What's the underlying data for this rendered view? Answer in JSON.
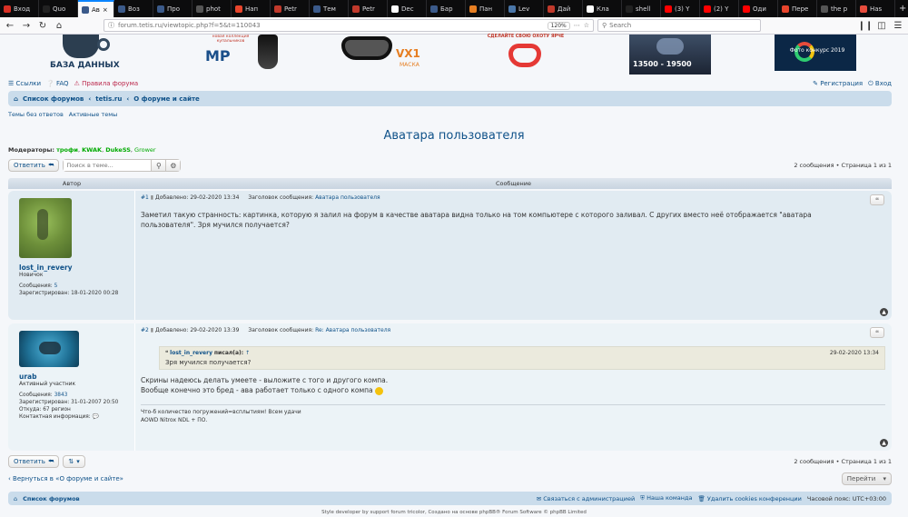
{
  "browser": {
    "tabs": [
      {
        "label": "Вход",
        "color": "#d93025",
        "icon": "gmail-icon"
      },
      {
        "label": "Quo",
        "color": "#222",
        "icon": "p-icon"
      },
      {
        "label": "Ав",
        "color": "#3b5a8a",
        "icon": "forum-icon",
        "active": true
      },
      {
        "label": "Воз",
        "color": "#3b5a8a",
        "icon": "forum-icon"
      },
      {
        "label": "Про",
        "color": "#3b5a8a",
        "icon": "forum-icon"
      },
      {
        "label": "phot",
        "color": "#555",
        "icon": "page-icon"
      },
      {
        "label": "Нап",
        "color": "#e8452c",
        "icon": "s-icon"
      },
      {
        "label": "Petr",
        "color": "#c0392b",
        "icon": "c-icon"
      },
      {
        "label": "Тем",
        "color": "#3b5a8a",
        "icon": "forum-icon"
      },
      {
        "label": "Petr",
        "color": "#c0392b",
        "icon": "c-icon"
      },
      {
        "label": "Dec",
        "color": "#fff",
        "icon": "w-icon"
      },
      {
        "label": "Бар",
        "color": "#3b5a8a",
        "icon": "forum-icon"
      },
      {
        "label": "Пан",
        "color": "#e67e22",
        "icon": "pin-icon"
      },
      {
        "label": "Lev",
        "color": "#4a76a8",
        "icon": "vk-icon"
      },
      {
        "label": "Дай",
        "color": "#c0392b",
        "icon": "stripe-icon"
      },
      {
        "label": "Кла",
        "color": "#fff",
        "icon": "w-icon"
      },
      {
        "label": "shell",
        "color": "#222",
        "icon": "a-icon"
      },
      {
        "label": "(3) Y",
        "color": "#ff0000",
        "icon": "youtube-icon"
      },
      {
        "label": "(2) Y",
        "color": "#ff0000",
        "icon": "youtube-icon"
      },
      {
        "label": "Оди",
        "color": "#ff0000",
        "icon": "youtube-icon"
      },
      {
        "label": "Пере",
        "color": "#e8452c",
        "icon": "g-icon"
      },
      {
        "label": "the p",
        "color": "#555",
        "icon": "page-icon"
      },
      {
        "label": "Has",
        "color": "#e74c3c",
        "icon": "h-icon"
      }
    ],
    "url": "forum.tetis.ru/viewtopic.php?f=5&t=110043",
    "zoom": "120%",
    "search_placeholder": "Search"
  },
  "banners": {
    "db_label": "БАЗА ДАННЫХ",
    "mp_text": "новая коллекция купальников",
    "mp_logo": "MP",
    "vx1": "VX1",
    "vx1_sub": "МАСКА",
    "hunt": "СДЕЛАЙТЕ СВОЮ ОХОТУ ЯРЧЕ",
    "price": "13500 - 19500",
    "contest": "Фото конкурс 2019"
  },
  "header": {
    "links": [
      "Ссылки",
      "FAQ",
      "Правила форума"
    ],
    "register": "Регистрация",
    "login": "Вход"
  },
  "breadcrumb": [
    "Список форумов",
    "tetis.ru",
    "О форуме и сайте"
  ],
  "quicklinks": [
    "Темы без ответов",
    "Активные темы"
  ],
  "topic": {
    "title": "Аватара пользователя",
    "mods_label": "Модераторы:",
    "mods": [
      "трофи",
      "KWAK",
      "DukeSS",
      "Grower"
    ],
    "reply_label": "Ответить",
    "search_placeholder": "Поиск в теме...",
    "pagination": "2 сообщения • Страница 1 из 1"
  },
  "table_header": {
    "author": "Автор",
    "message": "Сообщение"
  },
  "posts": [
    {
      "num": "#1",
      "date": "Добавлено: 29-02-2020 13:34",
      "subject_label": "Заголовок сообщения:",
      "subject": "Аватара пользователя",
      "author": "lost_in_revery",
      "rank": "Новичок",
      "messages_label": "Сообщения:",
      "messages": "5",
      "registered_label": "Зарегистрирован:",
      "registered": "18-01-2020 00:28",
      "text": "Заметил такую странность: картинка, которую я залил на форум в качестве аватара видна только на том компьютере с которого заливал. С других вместо неё отображается \"аватара пользователя\". Зря мучился получается?"
    },
    {
      "num": "#2",
      "date": "Добавлено: 29-02-2020 13:39",
      "subject_label": "Заголовок сообщения:",
      "subject": "Re: Аватара пользователя",
      "author": "urab",
      "rank": "Активный участник",
      "messages_label": "Сообщения:",
      "messages": "3843",
      "registered_label": "Зарегистрирован:",
      "registered": "31-01-2007 20:50",
      "from_label": "Откуда:",
      "from": "67 регион",
      "contact_label": "Контактная информация:",
      "quote_author": "lost_in_revery",
      "quote_wrote": "писал(а):",
      "quote_date": "29-02-2020 13:34",
      "quote_text": "Зря мучился получается?",
      "text1": "Скрины надеюсь делать умеете - выложите с того и другого компа.",
      "text2": "Вообще конечно это бред - ава работает только с одного компа",
      "sig1": "Что-б количество погружений=всплытиям! Всем удачи",
      "sig2": "AOWD Nitrox NDL + ПО."
    }
  ],
  "bottom": {
    "return": "Вернуться в «О форуме и сайте»",
    "goto": "Перейти"
  },
  "footer": {
    "home": "Список форумов",
    "contact": "Связаться с администрацией",
    "team": "Наша команда",
    "cookies": "Удалить cookies конференции",
    "timezone": "Часовой пояс: UTC+03:00",
    "credits": "Style developer by support forum tricolor, Создано на основе phpBB® Forum Software © phpBB Limited"
  }
}
